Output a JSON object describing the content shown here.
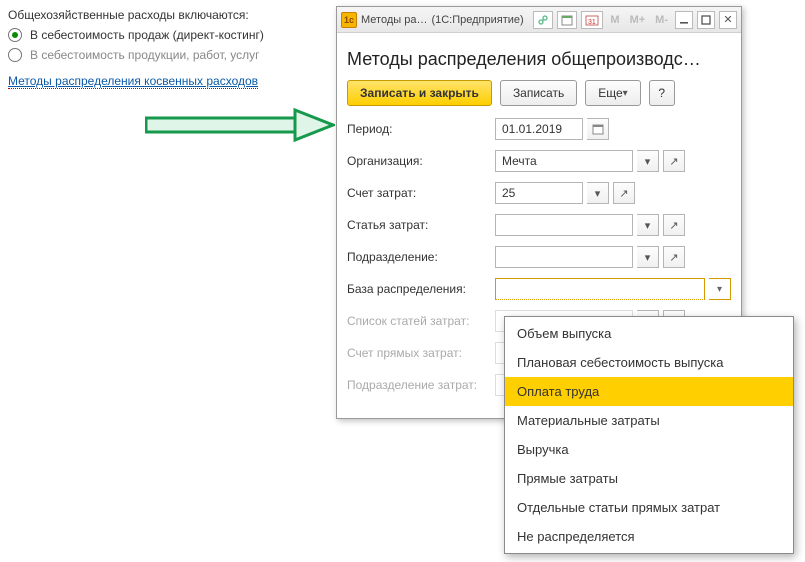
{
  "left": {
    "heading": "Общехозяйственные расходы включаются:",
    "opt1": "В себестоимость продаж (директ-костинг)",
    "opt2": "В  себестоимость продукции, работ, услуг",
    "link": "Методы распределения косвенных расходов"
  },
  "window": {
    "titlebar": {
      "title": "Методы ра…",
      "subtitle": "(1С:Предприятие)"
    },
    "heading": "Методы распределения общепроизводс…",
    "toolbar": {
      "save_close": "Записать и закрыть",
      "save": "Записать",
      "more": "Еще",
      "help": "?"
    },
    "fields": {
      "period_label": "Период:",
      "period_value": "01.01.2019",
      "org_label": "Организация:",
      "org_value": "Мечта",
      "account_label": "Счет затрат:",
      "account_value": "25",
      "article_label": "Статья затрат:",
      "article_value": "",
      "dept_label": "Подразделение:",
      "dept_value": "",
      "base_label": "База распределения:",
      "base_value": "",
      "list_label": "Список статей затрат:",
      "direct_acc_label": "Счет прямых затрат:",
      "direct_dept_label": "Подразделение затрат:"
    }
  },
  "dropdown": {
    "items": [
      "Объем выпуска",
      "Плановая себестоимость выпуска",
      "Оплата труда",
      "Материальные затраты",
      "Выручка",
      "Прямые затраты",
      "Отдельные статьи прямых затрат",
      "Не распределяется"
    ],
    "highlight_index": 2
  }
}
